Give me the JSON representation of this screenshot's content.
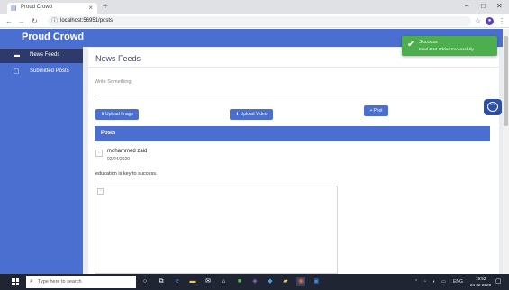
{
  "browser": {
    "tab_title": "Proud Crowd",
    "tab_close": "×",
    "new_tab": "+",
    "url": "localhost:56951/posts",
    "controls": {
      "minimize": "–",
      "maximize": "□",
      "close": "✕"
    }
  },
  "app": {
    "brand": "Proud Crowd",
    "sidebar": [
      {
        "label": "News Feeds",
        "icon": "list-icon",
        "active": true
      },
      {
        "label": "Submitted Posts",
        "icon": "document-icon",
        "active": false
      }
    ],
    "page_title": "News Feeds",
    "composer": {
      "placeholder": "Write Something",
      "upload_image": "Upload Image",
      "upload_video": "Upload Video",
      "post": "Post"
    },
    "posts_header": "Posts",
    "posts": [
      {
        "author": "mohammed zaid",
        "date": "02/24/2020",
        "text": "education is key to success."
      }
    ],
    "toast": {
      "title": "Success",
      "message": "Feed Post Added Successfully"
    }
  },
  "taskbar": {
    "search_placeholder": "Type here to search",
    "tray_text": "ENG",
    "time": "19:52",
    "date": "24-02-2020"
  },
  "colors": {
    "brand_blue": "#4a6fd0",
    "sidebar_active": "#2d3a6b",
    "toast_green": "#4cae4c",
    "taskbar": "#1f2533"
  }
}
